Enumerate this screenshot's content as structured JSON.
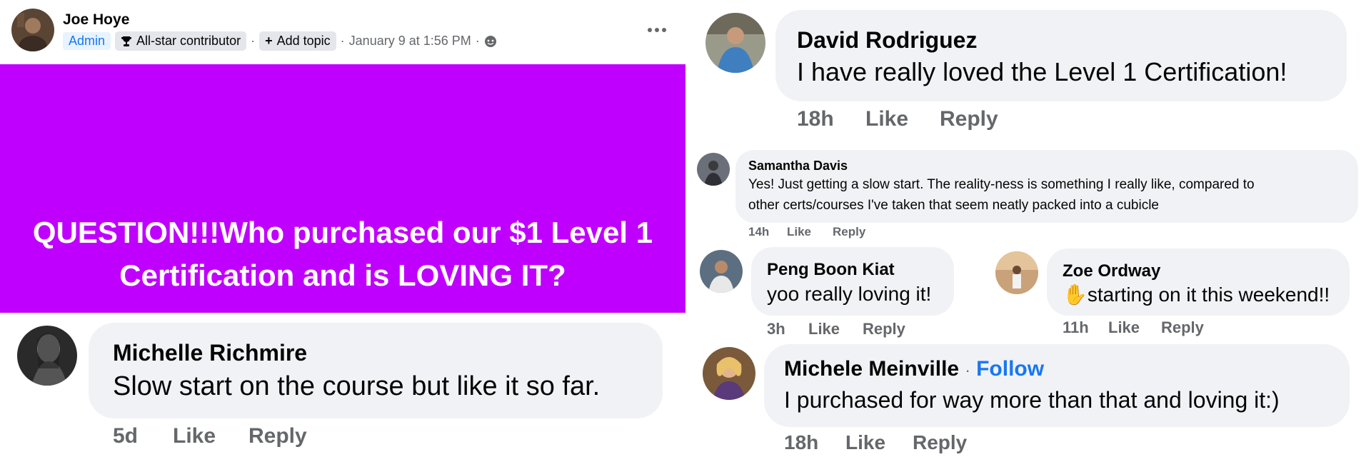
{
  "post": {
    "author": "Joe Hoye",
    "badge_admin": "Admin",
    "badge_contributor": "All-star contributor",
    "add_topic": "Add topic",
    "timestamp": "January 9 at 1:56 PM",
    "separator": "·",
    "more_icon": "more-horizontal-icon",
    "banner_text": "QUESTION!!!Who purchased our $1 Level 1 Certification and is LOVING IT?",
    "banner_color": "#c000ff"
  },
  "comments": {
    "michelle_r": {
      "name": "Michelle Richmire",
      "text": "Slow start on the course but like it so far.",
      "time": "5d",
      "like": "Like",
      "reply": "Reply"
    },
    "david": {
      "name": "David Rodriguez",
      "text": "I have really loved the Level 1 Certification!",
      "time": "18h",
      "like": "Like",
      "reply": "Reply"
    },
    "samantha": {
      "name": "Samantha Davis",
      "text_line1": "Yes! Just getting a slow start. The reality-ness is something I really like, compared to",
      "text_line2": "other certs/courses I've taken that seem neatly packed into a cubicle",
      "time": "14h",
      "like": "Like",
      "reply": "Reply"
    },
    "peng": {
      "name": "Peng Boon Kiat",
      "text": "yoo really loving it!",
      "time": "3h",
      "like": "Like",
      "reply": "Reply"
    },
    "zoe": {
      "name": "Zoe Ordway",
      "emoji": "✋",
      "text": "starting on it this weekend!!",
      "time": "11h",
      "like": "Like",
      "reply": "Reply"
    },
    "michele_m": {
      "name": "Michele Meinville",
      "follow": "Follow",
      "separator": "·",
      "text": "I purchased for way more than that and loving it:)",
      "time": "18h",
      "like": "Like",
      "reply": "Reply"
    }
  },
  "colors": {
    "link_blue": "#1877f2",
    "bubble_bg": "#f0f2f5",
    "muted_text": "#65676b"
  }
}
